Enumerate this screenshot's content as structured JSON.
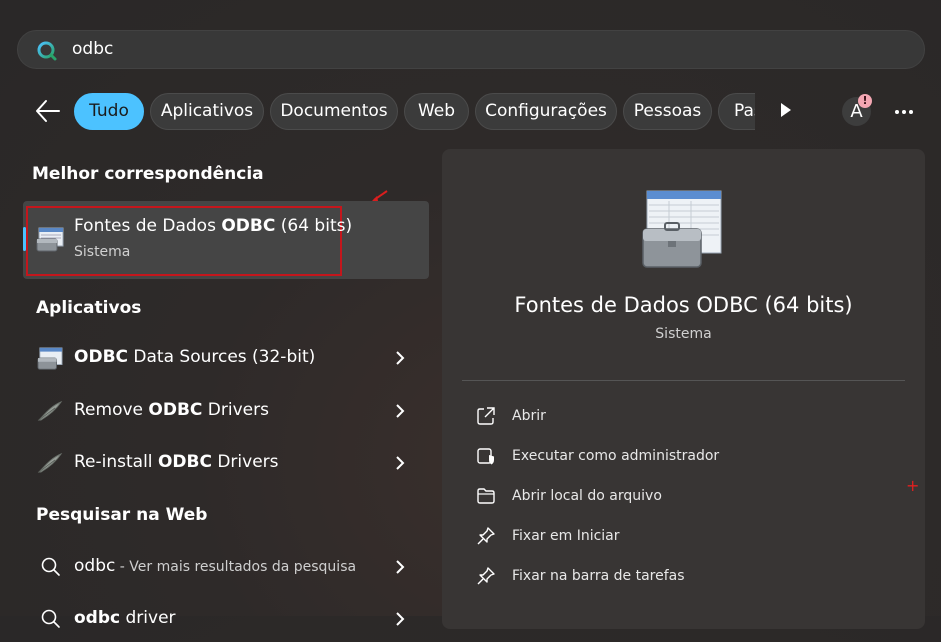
{
  "search": {
    "query": "odbc"
  },
  "filters": [
    {
      "label": "Tudo",
      "active": true
    },
    {
      "label": "Aplicativos"
    },
    {
      "label": "Documentos"
    },
    {
      "label": "Web"
    },
    {
      "label": "Configurações"
    },
    {
      "label": "Pessoas"
    },
    {
      "label": "Pas"
    }
  ],
  "account": {
    "avatar_letter": "A",
    "badge": "!"
  },
  "sections": {
    "best_match": "Melhor correspondência",
    "apps": "Aplicativos",
    "web": "Pesquisar na Web"
  },
  "best_match": {
    "title_pre": "Fontes de Dados ",
    "title_bold": "ODBC",
    "title_post": " (64 bits)",
    "subtitle": "Sistema"
  },
  "apps": [
    {
      "pre": "",
      "bold": "ODBC",
      "post": " Data Sources (32-bit)",
      "icon": "odbc-datasource-icon"
    },
    {
      "pre": "Remove ",
      "bold": "ODBC",
      "post": " Drivers",
      "icon": "feather-icon"
    },
    {
      "pre": "Re-install ",
      "bold": "ODBC",
      "post": " Drivers",
      "icon": "feather-icon"
    }
  ],
  "web_results": [
    {
      "query": "odbc",
      "hint": " - Ver mais resultados da pesquisa"
    },
    {
      "query_bold": "odbc",
      "query_rest": " driver"
    }
  ],
  "preview": {
    "title": "Fontes de Dados ODBC (64 bits)",
    "subtitle": "Sistema",
    "actions": [
      {
        "label": "Abrir",
        "icon": "open-external-icon"
      },
      {
        "label": "Executar como administrador",
        "icon": "shield-icon"
      },
      {
        "label": "Abrir local do arquivo",
        "icon": "folder-icon"
      },
      {
        "label": "Fixar em Iniciar",
        "icon": "pin-icon"
      },
      {
        "label": "Fixar na barra de tarefas",
        "icon": "pin-icon"
      }
    ]
  },
  "colors": {
    "accent": "#4cc2ff",
    "highlight_box": "#c4161c"
  }
}
